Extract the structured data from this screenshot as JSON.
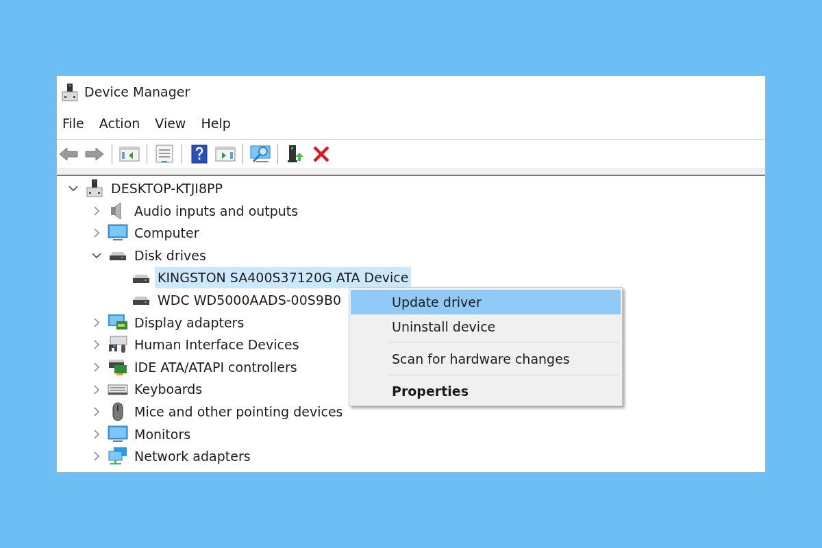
{
  "window": {
    "title": "Device Manager"
  },
  "menubar": [
    "File",
    "Action",
    "View",
    "Help"
  ],
  "toolbar": [
    {
      "kind": "back"
    },
    {
      "kind": "forward"
    },
    {
      "kind": "separator"
    },
    {
      "kind": "tree-pane"
    },
    {
      "kind": "separator"
    },
    {
      "kind": "properties"
    },
    {
      "kind": "separator"
    },
    {
      "kind": "help"
    },
    {
      "kind": "action-pane"
    },
    {
      "kind": "separator"
    },
    {
      "kind": "scan"
    },
    {
      "kind": "separator"
    },
    {
      "kind": "update"
    },
    {
      "kind": "uninstall"
    }
  ],
  "tree": {
    "label": "DESKTOP-KTJI8PP",
    "kind": "computer-root",
    "expanded": true,
    "selected": false,
    "children": [
      {
        "label": "Audio inputs and outputs",
        "kind": "audio",
        "expanded": false,
        "selected": false
      },
      {
        "label": "Computer",
        "kind": "monitor",
        "expanded": false,
        "selected": false
      },
      {
        "label": "Disk drives",
        "kind": "disk",
        "expanded": true,
        "selected": false,
        "children": [
          {
            "label": "KINGSTON SA400S37120G ATA Device",
            "kind": "disk",
            "selected": true
          },
          {
            "label": "WDC WD5000AADS-00S9B0",
            "kind": "disk",
            "selected": false
          }
        ]
      },
      {
        "label": "Display adapters",
        "kind": "display",
        "expanded": false,
        "selected": false
      },
      {
        "label": "Human Interface Devices",
        "kind": "hid",
        "expanded": false,
        "selected": false
      },
      {
        "label": "IDE ATA/ATAPI controllers",
        "kind": "ide",
        "expanded": false,
        "selected": false
      },
      {
        "label": "Keyboards",
        "kind": "keyboard",
        "expanded": false,
        "selected": false
      },
      {
        "label": "Mice and other pointing devices",
        "kind": "mouse",
        "expanded": false,
        "selected": false
      },
      {
        "label": "Monitors",
        "kind": "monitor",
        "expanded": false,
        "selected": false
      },
      {
        "label": "Network adapters",
        "kind": "network",
        "expanded": false,
        "selected": false
      }
    ]
  },
  "context_menu": [
    {
      "kind": "item",
      "label": "Update driver",
      "selected": true,
      "default": false
    },
    {
      "kind": "item",
      "label": "Uninstall device",
      "selected": false,
      "default": false
    },
    {
      "kind": "separator"
    },
    {
      "kind": "item",
      "label": "Scan for hardware changes",
      "selected": false,
      "default": false
    },
    {
      "kind": "separator"
    },
    {
      "kind": "item",
      "label": "Properties",
      "selected": false,
      "default": true
    }
  ]
}
